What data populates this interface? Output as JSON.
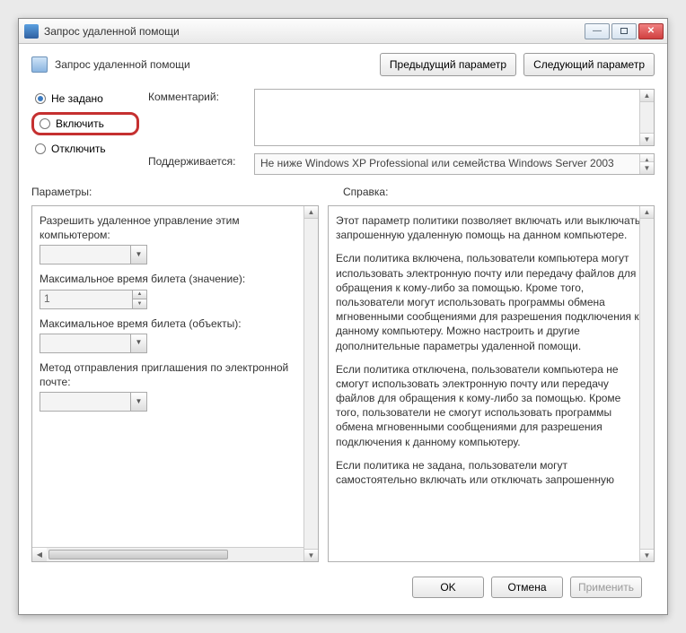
{
  "window": {
    "title": "Запрос удаленной помощи"
  },
  "header": {
    "title": "Запрос удаленной помощи",
    "prev": "Предыдущий параметр",
    "next": "Следующий параметр"
  },
  "state": {
    "options": {
      "not_configured": "Не задано",
      "enabled": "Включить",
      "disabled": "Отключить"
    },
    "comment_label": "Комментарий:",
    "supported_label": "Поддерживается:",
    "supported_text": "Не ниже Windows XP Professional или семейства Windows Server 2003"
  },
  "section_labels": {
    "params": "Параметры:",
    "help": "Справка:"
  },
  "params": {
    "allow_remote_label": "Разрешить удаленное управление этим компьютером:",
    "ticket_value_label": "Максимальное время билета (значение):",
    "ticket_value": "1",
    "ticket_units_label": "Максимальное время билета (объекты):",
    "invite_method_label": "Метод отправления приглашения по электронной почте:"
  },
  "help": {
    "p1": "Этот параметр политики позволяет включать или выключать запрошенную удаленную помощь на данном компьютере.",
    "p2": "Если политика включена, пользователи компьютера могут использовать электронную почту или передачу файлов для обращения к кому-либо за помощью. Кроме того, пользователи могут использовать программы обмена мгновенными сообщениями для разрешения подключения к данному компьютеру. Можно настроить и другие дополнительные параметры удаленной помощи.",
    "p3": "Если политика отключена, пользователи компьютера не смогут использовать электронную почту или передачу файлов для обращения к кому-либо за помощью. Кроме того, пользователи не смогут использовать программы обмена мгновенными сообщениями для разрешения подключения к данному компьютеру.",
    "p4": "Если политика не задана, пользователи могут самостоятельно включать или отключать запрошенную"
  },
  "footer": {
    "ok": "OK",
    "cancel": "Отмена",
    "apply": "Применить"
  }
}
